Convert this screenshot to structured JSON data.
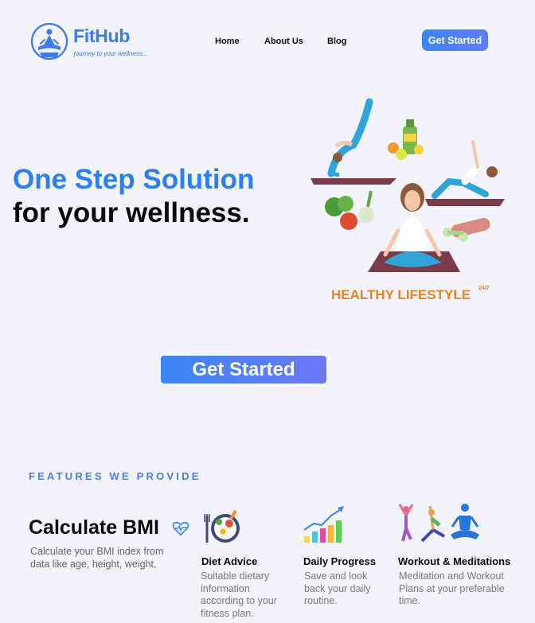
{
  "brand": {
    "name": "FitHub",
    "tagline": "journey to your wellness..."
  },
  "nav": {
    "links": [
      "Home",
      "About Us",
      "Blog"
    ],
    "cta": "Get Started"
  },
  "hero": {
    "line1": "One Step Solution",
    "line2": "for your wellness.",
    "illustration_caption": "HEALTHY LIFESTYLE",
    "illustration_superscript": "24/7",
    "cta": "Get Started"
  },
  "features": {
    "heading": "FEATURES WE PROVIDE",
    "bmi": {
      "title": "Calculate BMI",
      "description": "Calculate your BMI index from data like age, height, weight."
    },
    "items": [
      {
        "title": "Diet Advice",
        "description": "Suitable dietary information according to your fitness plan.",
        "icon": "diet-plate-icon"
      },
      {
        "title": "Daily Progress",
        "description": "Save and look back your daily routine.",
        "icon": "progress-chart-icon"
      },
      {
        "title": "Workout & Meditations",
        "description": "Meditation and Workout Plans at your preferable time.",
        "icon": "workout-people-icon"
      }
    ]
  },
  "colors": {
    "background": "#f2f3fb",
    "accent": "#2b7ff0",
    "button_gradient_start": "#3b86f7",
    "button_gradient_end": "#6b78f5"
  }
}
